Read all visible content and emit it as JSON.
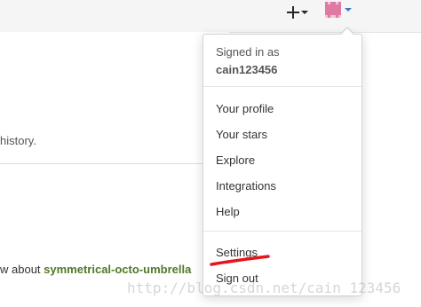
{
  "header": {
    "new_menu_icon": "plus-icon",
    "avatar_icon": "identicon-avatar",
    "avatar_color": "#e89ab8",
    "accent_color": "#4078c0"
  },
  "main": {
    "history_text": "history.",
    "news_prefix": "w about ",
    "news_repo": "symmetrical-octo-umbrella"
  },
  "dropdown": {
    "signed_in_label": "Signed in as",
    "username": "cain123456",
    "items": [
      {
        "label": "Your profile"
      },
      {
        "label": "Your stars"
      },
      {
        "label": "Explore"
      },
      {
        "label": "Integrations"
      },
      {
        "label": "Help"
      },
      {
        "label": "Settings"
      },
      {
        "label": "Sign out"
      }
    ],
    "highlight_color": "#e8141c"
  },
  "watermark": "http://blog.csdn.net/cain_123456"
}
